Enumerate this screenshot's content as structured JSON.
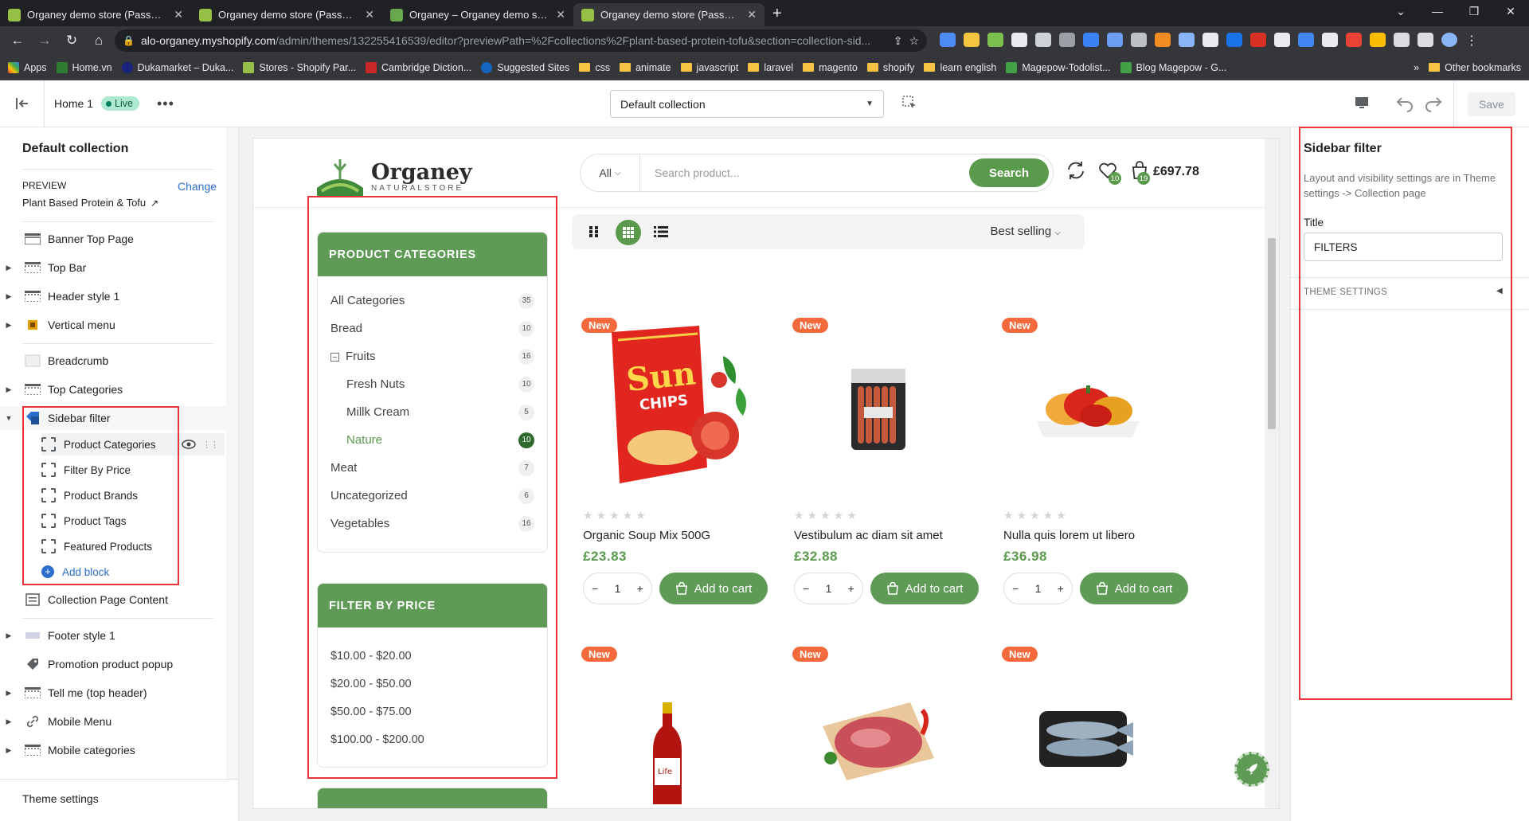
{
  "browser": {
    "tabs": [
      {
        "title": "Organey demo store (Password: ...",
        "active": false
      },
      {
        "title": "Organey demo store (Password: ...",
        "active": false
      },
      {
        "title": "Organey – Organey demo store (...",
        "active": false
      },
      {
        "title": "Organey demo store (Password: ...",
        "active": true
      }
    ],
    "url_host": "alo-organey.myshopify.com",
    "url_path": "/admin/themes/132255416539/editor?previewPath=%2Fcollections%2Fplant-based-protein-tofu&section=collection-sid...",
    "bookmarks": [
      "Apps",
      "Home.vn",
      "Dukamarket – Duka...",
      "Stores - Shopify Par...",
      "Cambridge Diction...",
      "Suggested Sites",
      "css",
      "animate",
      "javascript",
      "laravel",
      "magento",
      "shopify",
      "learn english",
      "Magepow-Todolist...",
      "Blog Magepow - G..."
    ],
    "other_bookmarks": "Other bookmarks",
    "overflow": "»"
  },
  "editor": {
    "theme_name": "Home 1",
    "live_badge": "Live",
    "template_select": "Default collection",
    "save_label": "Save"
  },
  "left_panel": {
    "title": "Default collection",
    "preview_label": "PREVIEW",
    "change_label": "Change",
    "preview_product": "Plant Based Protein & Tofu",
    "sections": [
      {
        "label": "Banner Top Page",
        "caret": false
      },
      {
        "label": "Top Bar",
        "caret": true
      },
      {
        "label": "Header style 1",
        "caret": true
      },
      {
        "label": "Vertical menu",
        "caret": true
      },
      {
        "label": "Breadcrumb",
        "caret": false
      },
      {
        "label": "Top Categories",
        "caret": true
      },
      {
        "label": "Sidebar filter",
        "caret": true,
        "expanded": true
      }
    ],
    "blocks": [
      "Product Categories",
      "Filter By Price",
      "Product Brands",
      "Product Tags",
      "Featured Products"
    ],
    "add_block": "Add block",
    "after_sections": [
      {
        "label": "Collection Page Content",
        "caret": false
      },
      {
        "label": "Footer style 1",
        "caret": true
      },
      {
        "label": "Promotion product popup",
        "caret": false
      },
      {
        "label": "Tell me (top header)",
        "caret": true
      },
      {
        "label": "Mobile Menu",
        "caret": true
      },
      {
        "label": "Mobile categories",
        "caret": true
      }
    ],
    "theme_settings": "Theme settings"
  },
  "store": {
    "logo_name": "Organey",
    "logo_sub": "NATURALSTORE",
    "search_category": "All",
    "search_placeholder": "Search product...",
    "search_button": "Search",
    "wishlist_count": "10",
    "cart_count": "19",
    "cart_total": "£697.78",
    "categories_title": "PRODUCT CATEGORIES",
    "categories": [
      {
        "name": "All Categories",
        "count": "35",
        "level": 0
      },
      {
        "name": "Bread",
        "count": "10",
        "level": 0
      },
      {
        "name": "Fruits",
        "count": "16",
        "level": 0,
        "expanded": true
      },
      {
        "name": "Fresh Nuts",
        "count": "10",
        "level": 1
      },
      {
        "name": "Millk Cream",
        "count": "5",
        "level": 1
      },
      {
        "name": "Nature",
        "count": "10",
        "level": 1,
        "active": true
      },
      {
        "name": "Meat",
        "count": "7",
        "level": 0
      },
      {
        "name": "Uncategorized",
        "count": "6",
        "level": 0
      },
      {
        "name": "Vegetables",
        "count": "16",
        "level": 0
      }
    ],
    "price_title": "FILTER BY PRICE",
    "price_ranges": [
      "$10.00 - $20.00",
      "$20.00 - $50.00",
      "$50.00 - $75.00",
      "$100.00 - $200.00"
    ],
    "sort_label": "Best selling",
    "new_badge": "New",
    "add_to_cart": "Add to cart",
    "products": [
      {
        "name": "Organic Soup Mix 500G",
        "price": "£23.83",
        "qty": "1",
        "image": "chips-bag"
      },
      {
        "name": "Vestibulum ac diam sit amet",
        "price": "£32.88",
        "qty": "1",
        "image": "sausage-pack"
      },
      {
        "name": "Nulla quis lorem ut libero",
        "price": "£36.98",
        "qty": "1",
        "image": "peppers"
      },
      {
        "name": "",
        "price": "",
        "qty": "",
        "image": "ketchup-bottle"
      },
      {
        "name": "",
        "price": "",
        "qty": "",
        "image": "meat-board"
      },
      {
        "name": "",
        "price": "",
        "qty": "",
        "image": "fish-tray"
      }
    ]
  },
  "right_panel": {
    "title": "Sidebar filter",
    "info": "Layout and visibility settings are in Theme settings -> Collection page",
    "title_label": "Title",
    "title_value": "FILTERS",
    "theme_settings": "THEME SETTINGS"
  },
  "colors": {
    "brand_green": "#5f9a57",
    "new_badge": "#f46a3c",
    "highlight_red": "#e8333a",
    "shopify_link": "#2c6ecb"
  }
}
